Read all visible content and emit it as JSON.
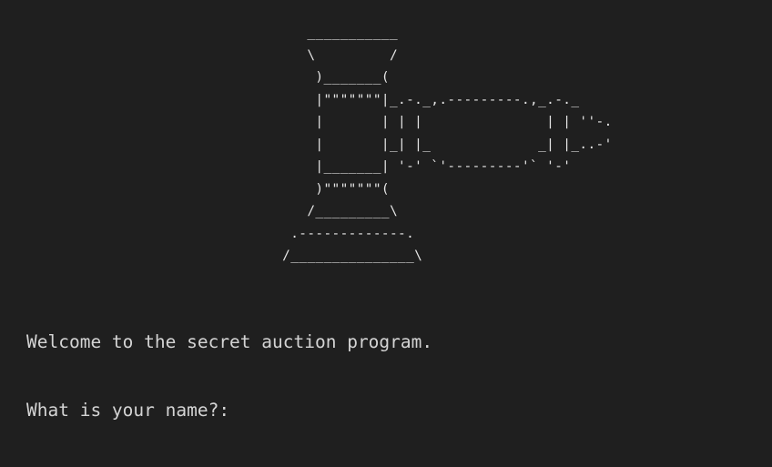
{
  "terminal": {
    "background": "#1f1f1f",
    "foreground": "#d4d4d4",
    "ascii_art": "     ___________\n     \\         /\n      )_______(\n      |\"\"\"\"\"\"\"|_.-._,.---------.,_.-._\n      |       | | |               | | ''-.\n      |       |_| |_             _| |_..-'\n      |_______| '-' `'---------'` '-'\n      )\"\"\"\"\"\"\"(\n     /_________\\\n   .-------------.\n  /_______________\\",
    "welcome_text": "Welcome to the secret auction program.",
    "prompt_text": "What is your name?:",
    "input_value": ""
  }
}
